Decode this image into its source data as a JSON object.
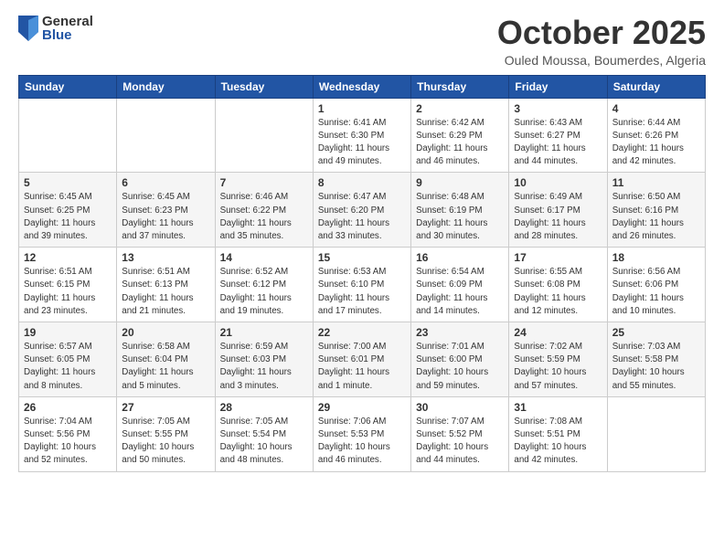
{
  "logo": {
    "general": "General",
    "blue": "Blue"
  },
  "title": "October 2025",
  "subtitle": "Ouled Moussa, Boumerdes, Algeria",
  "days_of_week": [
    "Sunday",
    "Monday",
    "Tuesday",
    "Wednesday",
    "Thursday",
    "Friday",
    "Saturday"
  ],
  "weeks": [
    [
      {
        "day": "",
        "info": ""
      },
      {
        "day": "",
        "info": ""
      },
      {
        "day": "",
        "info": ""
      },
      {
        "day": "1",
        "info": "Sunrise: 6:41 AM\nSunset: 6:30 PM\nDaylight: 11 hours\nand 49 minutes."
      },
      {
        "day": "2",
        "info": "Sunrise: 6:42 AM\nSunset: 6:29 PM\nDaylight: 11 hours\nand 46 minutes."
      },
      {
        "day": "3",
        "info": "Sunrise: 6:43 AM\nSunset: 6:27 PM\nDaylight: 11 hours\nand 44 minutes."
      },
      {
        "day": "4",
        "info": "Sunrise: 6:44 AM\nSunset: 6:26 PM\nDaylight: 11 hours\nand 42 minutes."
      }
    ],
    [
      {
        "day": "5",
        "info": "Sunrise: 6:45 AM\nSunset: 6:25 PM\nDaylight: 11 hours\nand 39 minutes."
      },
      {
        "day": "6",
        "info": "Sunrise: 6:45 AM\nSunset: 6:23 PM\nDaylight: 11 hours\nand 37 minutes."
      },
      {
        "day": "7",
        "info": "Sunrise: 6:46 AM\nSunset: 6:22 PM\nDaylight: 11 hours\nand 35 minutes."
      },
      {
        "day": "8",
        "info": "Sunrise: 6:47 AM\nSunset: 6:20 PM\nDaylight: 11 hours\nand 33 minutes."
      },
      {
        "day": "9",
        "info": "Sunrise: 6:48 AM\nSunset: 6:19 PM\nDaylight: 11 hours\nand 30 minutes."
      },
      {
        "day": "10",
        "info": "Sunrise: 6:49 AM\nSunset: 6:17 PM\nDaylight: 11 hours\nand 28 minutes."
      },
      {
        "day": "11",
        "info": "Sunrise: 6:50 AM\nSunset: 6:16 PM\nDaylight: 11 hours\nand 26 minutes."
      }
    ],
    [
      {
        "day": "12",
        "info": "Sunrise: 6:51 AM\nSunset: 6:15 PM\nDaylight: 11 hours\nand 23 minutes."
      },
      {
        "day": "13",
        "info": "Sunrise: 6:51 AM\nSunset: 6:13 PM\nDaylight: 11 hours\nand 21 minutes."
      },
      {
        "day": "14",
        "info": "Sunrise: 6:52 AM\nSunset: 6:12 PM\nDaylight: 11 hours\nand 19 minutes."
      },
      {
        "day": "15",
        "info": "Sunrise: 6:53 AM\nSunset: 6:10 PM\nDaylight: 11 hours\nand 17 minutes."
      },
      {
        "day": "16",
        "info": "Sunrise: 6:54 AM\nSunset: 6:09 PM\nDaylight: 11 hours\nand 14 minutes."
      },
      {
        "day": "17",
        "info": "Sunrise: 6:55 AM\nSunset: 6:08 PM\nDaylight: 11 hours\nand 12 minutes."
      },
      {
        "day": "18",
        "info": "Sunrise: 6:56 AM\nSunset: 6:06 PM\nDaylight: 11 hours\nand 10 minutes."
      }
    ],
    [
      {
        "day": "19",
        "info": "Sunrise: 6:57 AM\nSunset: 6:05 PM\nDaylight: 11 hours\nand 8 minutes."
      },
      {
        "day": "20",
        "info": "Sunrise: 6:58 AM\nSunset: 6:04 PM\nDaylight: 11 hours\nand 5 minutes."
      },
      {
        "day": "21",
        "info": "Sunrise: 6:59 AM\nSunset: 6:03 PM\nDaylight: 11 hours\nand 3 minutes."
      },
      {
        "day": "22",
        "info": "Sunrise: 7:00 AM\nSunset: 6:01 PM\nDaylight: 11 hours\nand 1 minute."
      },
      {
        "day": "23",
        "info": "Sunrise: 7:01 AM\nSunset: 6:00 PM\nDaylight: 10 hours\nand 59 minutes."
      },
      {
        "day": "24",
        "info": "Sunrise: 7:02 AM\nSunset: 5:59 PM\nDaylight: 10 hours\nand 57 minutes."
      },
      {
        "day": "25",
        "info": "Sunrise: 7:03 AM\nSunset: 5:58 PM\nDaylight: 10 hours\nand 55 minutes."
      }
    ],
    [
      {
        "day": "26",
        "info": "Sunrise: 7:04 AM\nSunset: 5:56 PM\nDaylight: 10 hours\nand 52 minutes."
      },
      {
        "day": "27",
        "info": "Sunrise: 7:05 AM\nSunset: 5:55 PM\nDaylight: 10 hours\nand 50 minutes."
      },
      {
        "day": "28",
        "info": "Sunrise: 7:05 AM\nSunset: 5:54 PM\nDaylight: 10 hours\nand 48 minutes."
      },
      {
        "day": "29",
        "info": "Sunrise: 7:06 AM\nSunset: 5:53 PM\nDaylight: 10 hours\nand 46 minutes."
      },
      {
        "day": "30",
        "info": "Sunrise: 7:07 AM\nSunset: 5:52 PM\nDaylight: 10 hours\nand 44 minutes."
      },
      {
        "day": "31",
        "info": "Sunrise: 7:08 AM\nSunset: 5:51 PM\nDaylight: 10 hours\nand 42 minutes."
      },
      {
        "day": "",
        "info": ""
      }
    ]
  ]
}
